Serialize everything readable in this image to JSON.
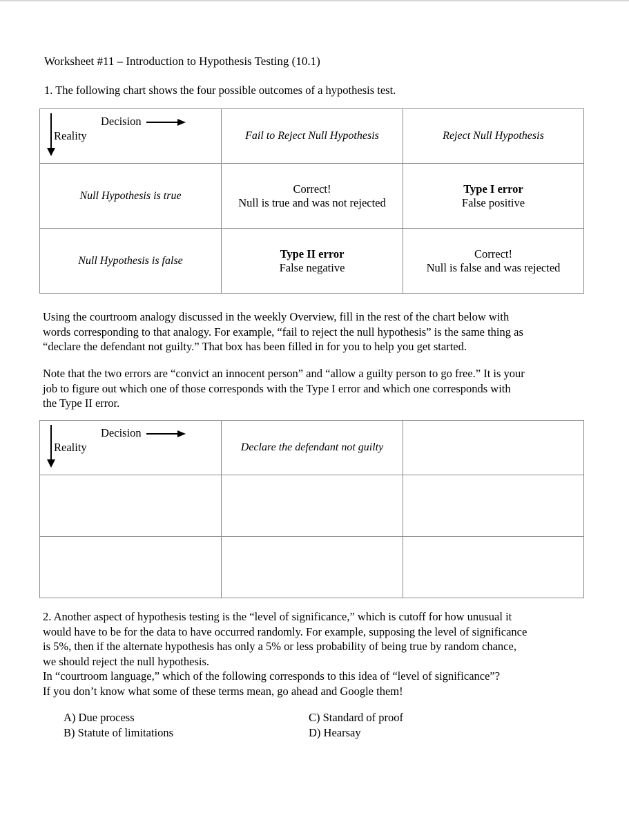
{
  "document": {
    "title": "Worksheet #11 – Introduction to Hypothesis Testing (10.1)",
    "question1": "1. The following chart shows the four possible outcomes of a hypothesis test."
  },
  "axis": {
    "decision_label": "Decision",
    "reality_label": "Reality",
    "decision_arrow": "arrow-right-icon",
    "reality_arrow": "arrow-down-icon"
  },
  "chart1": {
    "columns": [
      "Fail to Reject Null Hypothesis",
      "Reject Null Hypothesis"
    ],
    "rows": [
      {
        "label": "Null Hypothesis is true",
        "cells": [
          {
            "title": "Correct!",
            "bold": false,
            "subtitle": "Null is true and was not rejected"
          },
          {
            "title": "Type I error",
            "bold": true,
            "subtitle": "False positive"
          }
        ]
      },
      {
        "label": "Null Hypothesis is false",
        "cells": [
          {
            "title": "Type II error",
            "bold": true,
            "subtitle": "False negative"
          },
          {
            "title": "Correct!",
            "bold": false,
            "subtitle": "Null is false and was rejected"
          }
        ]
      }
    ]
  },
  "paragraphs": {
    "analogy": [
      "Using the courtroom analogy discussed in the weekly Overview, fill in the rest of the chart below with",
      "words corresponding to that analogy. For example, “fail to reject the null hypothesis” is the same thing as",
      "“declare the defendant not guilty.” That box has been filled in for you to help you get started."
    ],
    "errors": [
      "Note that the two errors are “convict an innocent person” and “allow a guilty person to go free.” It is your",
      "job to figure out which one of those corresponds with the Type I error and which one corresponds with",
      "the Type II error."
    ],
    "question2": [
      "2. Another aspect of hypothesis testing is the “level of significance,” which is cutoff for how unusual it",
      "would have to be for the data to have occurred randomly. For example, supposing the level of significance",
      "is 5%, then if the alternate hypothesis has only a 5% or less probability of being true by random chance,",
      "we should reject the null hypothesis.",
      "In “courtroom language,” which of the following corresponds to this idea of “level of significance”?",
      "If you don’t know what some of these terms mean, go ahead and Google them!"
    ]
  },
  "chart2": {
    "columns": [
      "Declare the defendant not guilty",
      ""
    ],
    "rows": [
      {
        "label": "",
        "cells": [
          {
            "title": "",
            "subtitle": ""
          },
          {
            "title": "",
            "subtitle": ""
          }
        ]
      },
      {
        "label": "",
        "cells": [
          {
            "title": "",
            "subtitle": ""
          },
          {
            "title": "",
            "subtitle": ""
          }
        ]
      }
    ]
  },
  "options": {
    "a": "A)  Due process",
    "b": "B)  Statute of limitations",
    "c": "C) Standard of proof",
    "d": "D) Hearsay"
  }
}
